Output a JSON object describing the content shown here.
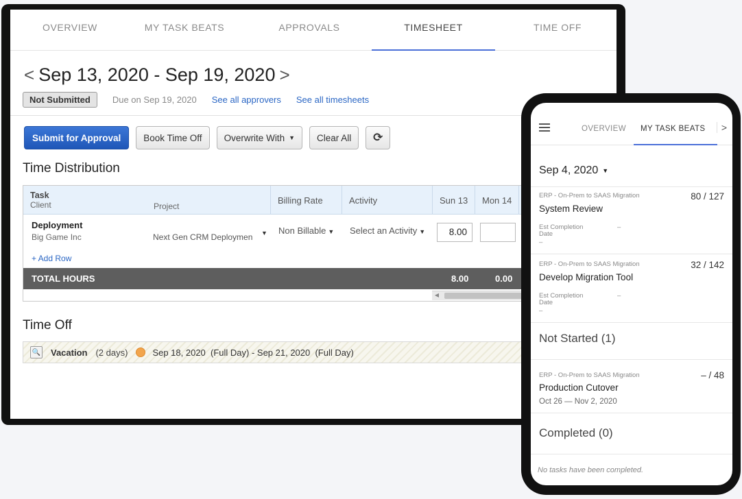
{
  "desktop": {
    "tabs": [
      {
        "label": "OVERVIEW"
      },
      {
        "label": "MY TASK BEATS"
      },
      {
        "label": "APPROVALS"
      },
      {
        "label": "TIMESHEET"
      },
      {
        "label": "TIME OFF"
      }
    ],
    "date_range": "Sep 13, 2020 - Sep 19, 2020",
    "prev_glyph": "<",
    "next_glyph": ">",
    "status": "Not Submitted",
    "due": "Due on Sep 19, 2020",
    "link_approvers": "See all approvers",
    "link_timesheets": "See all timesheets",
    "toolbar": {
      "submit": "Submit for Approval",
      "book_time_off": "Book Time Off",
      "overwrite_with": "Overwrite With",
      "clear_all": "Clear All",
      "refresh_glyph": "⟳"
    },
    "time_distribution_title": "Time Distribution",
    "table": {
      "headers": {
        "task": "Task",
        "client": "Client",
        "project": "Project",
        "billing_rate": "Billing Rate",
        "activity": "Activity",
        "sun": "Sun 13",
        "mon": "Mon 14"
      },
      "row": {
        "task": "Deployment",
        "client": "Big Game Inc",
        "project": "Next Gen CRM Deploymen",
        "billing": "Non Billable",
        "activity": "Select an Activity",
        "sun_value": "8.00",
        "mon_value": ""
      },
      "add_row": "+ Add Row",
      "total_label": "TOTAL HOURS",
      "total_sun": "8.00",
      "total_mon": "0.00"
    },
    "time_off_title": "Time Off",
    "time_off": {
      "type": "Vacation",
      "days": "(2 days)",
      "range": "Sep 18, 2020  (Full Day) - Sep 21, 2020  (Full Day)"
    }
  },
  "phone": {
    "tabs": [
      {
        "label": "OVERVIEW"
      },
      {
        "label": "MY TASK BEATS"
      }
    ],
    "next_glyph": ">",
    "date": "Sep 4, 2020",
    "tasks": [
      {
        "project": "ERP - On-Prem to SAAS Migration",
        "name": "System Review",
        "count": "80 / 127",
        "est_label": "Est Completion",
        "est_label2": "Date",
        "est_value": "–",
        "est_value2": "–"
      },
      {
        "project": "ERP - On-Prem to SAAS Migration",
        "name": "Develop Migration Tool",
        "count": "32 / 142",
        "est_label": "Est Completion",
        "est_label2": "Date",
        "est_value": "–",
        "est_value2": "–"
      }
    ],
    "not_started_title": "Not Started (1)",
    "not_started_task": {
      "project": "ERP - On-Prem to SAAS Migration",
      "name": "Production Cutover",
      "count": "– / 48",
      "dates": "Oct 26 — Nov 2, 2020"
    },
    "completed_title": "Completed (0)",
    "completed_empty": "No tasks have been completed."
  },
  "colors": {
    "accent": "#4a6fd8",
    "primary_button": "#2a62c6",
    "link": "#2a66c4",
    "total_bar": "#5e5e5e",
    "header_bg": "#e7f1fb"
  }
}
